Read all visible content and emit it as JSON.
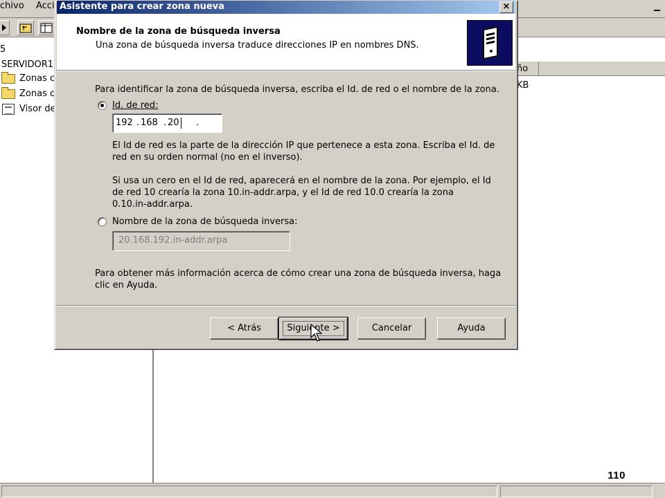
{
  "background_window": {
    "menu": [
      "chivo",
      "Acci"
    ],
    "tree_items": [
      {
        "label": "5"
      },
      {
        "label": "SERVIDOR1"
      },
      {
        "label": "Zonas c"
      },
      {
        "label": "Zonas c"
      },
      {
        "label": "Visor de"
      }
    ],
    "list_header": "ño",
    "list_value": "KB"
  },
  "dialog": {
    "title": "Asistente para crear zona nueva",
    "close_label": "×",
    "header_title": "Nombre de la zona de búsqueda inversa",
    "header_subtitle": "Una zona de búsqueda inversa traduce direcciones IP en nombres DNS.",
    "intro": "Para identificar la zona de búsqueda inversa, escriba el Id. de red o el nombre de la zona.",
    "option_network_id": {
      "label": "Id. de red:",
      "selected": true,
      "ip_parts": [
        "192",
        "168",
        "20",
        ""
      ]
    },
    "network_id_help_1": [
      "El Id de red es la parte de la dirección IP que pertenece a esta zona. Escriba el Id. de",
      "red en su orden normal (no en el inverso)."
    ],
    "network_id_help_2": [
      "Si usa un cero en el Id de red, aparecerá en el nombre de la zona.  Por ejemplo, el Id",
      "de red 10 crearía la zona 10.in-addr.arpa, y el Id de red 10.0 crearía la zona",
      "0.10.in-addr.arpa."
    ],
    "option_zone_name": {
      "label": "Nombre de la zona de búsqueda inversa:",
      "selected": false,
      "value": "20.168.192.in-addr.arpa"
    },
    "more_info": [
      "Para obtener más información acerca de cómo crear una zona de búsqueda inversa, haga",
      "clic en Ayuda."
    ],
    "buttons": {
      "back": "< Atrás",
      "next": "Siguiente >",
      "cancel": "Cancelar",
      "help": "Ayuda"
    }
  },
  "page_number": "110"
}
